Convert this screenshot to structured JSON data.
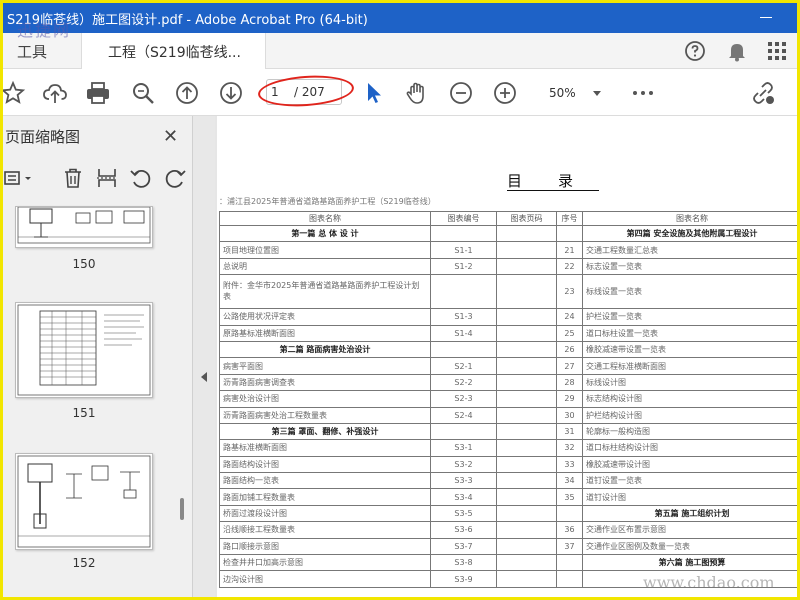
{
  "window": {
    "title": "S219临苍线）施工图设计.pdf - Adobe Acrobat Pro (64-bit)"
  },
  "tabs": {
    "tools_label": "工具",
    "document_tab_label": "工程（S219临苍线..."
  },
  "toolbar": {
    "current_page": "1",
    "total_pages": "/ 207",
    "zoom": "50%"
  },
  "thumbnail_panel": {
    "title": "页面缩略图",
    "pages": [
      "150",
      "151",
      "152"
    ]
  },
  "document": {
    "title": "目　　录",
    "subtitle": "：浦江县2025年普通省道路基路面养护工程（S219临苍线）",
    "headers": [
      "图表名称",
      "图表编号",
      "图表页码",
      "序号",
      "图表名称"
    ],
    "rows": [
      {
        "left": "第一篇  总 体 设 计",
        "left_head": true,
        "code": "",
        "no": "",
        "right": "第四篇  安全设施及其他附属工程设计",
        "right_head": true
      },
      {
        "left": "项目地理位置图",
        "code": "S1-1",
        "no": "21",
        "right": "交通工程数量汇总表"
      },
      {
        "left": "总说明",
        "code": "S1-2",
        "no": "22",
        "right": "标志设置一览表"
      },
      {
        "left": "附件：金华市2025年普通省道路基路面养护工程设计划表",
        "code": "",
        "no": "23",
        "right": "标线设置一览表",
        "tall": true
      },
      {
        "left": "公路使用状况评定表",
        "code": "S1-3",
        "no": "24",
        "right": "护栏设置一览表"
      },
      {
        "left": "原路基标准横断面图",
        "code": "S1-4",
        "no": "25",
        "right": "道口标柱设置一览表"
      },
      {
        "left": "第二篇  路面病害处治设计",
        "left_head": true,
        "code": "",
        "no": "26",
        "right": "橡胶减速带设置一览表"
      },
      {
        "left": "病害平面图",
        "code": "S2-1",
        "no": "27",
        "right": "交通工程标准横断面图"
      },
      {
        "left": "沥青路面病害调查表",
        "code": "S2-2",
        "no": "28",
        "right": "标线设计图"
      },
      {
        "left": "病害处治设计图",
        "code": "S2-3",
        "no": "29",
        "right": "标志结构设计图"
      },
      {
        "left": "沥青路面病害处治工程数量表",
        "code": "S2-4",
        "no": "30",
        "right": "护栏结构设计图"
      },
      {
        "left": "第三篇  罩面、翻修、补强设计",
        "left_head": true,
        "code": "",
        "no": "31",
        "right": "轮廓标一般构造图"
      },
      {
        "left": "路基标准横断面图",
        "code": "S3-1",
        "no": "32",
        "right": "道口标柱结构设计图"
      },
      {
        "left": "路面结构设计图",
        "code": "S3-2",
        "no": "33",
        "right": "橡胶减速带设计图"
      },
      {
        "left": "路面结构一览表",
        "code": "S3-3",
        "no": "34",
        "right": "道钉设置一览表"
      },
      {
        "left": "路面加铺工程数量表",
        "code": "S3-4",
        "no": "35",
        "right": "道钉设计图"
      },
      {
        "left": "桥面过渡段设计图",
        "code": "S3-5",
        "no": "",
        "right": "第五篇  施工组织计划",
        "right_head": true
      },
      {
        "left": "沿线顺接工程数量表",
        "code": "S3-6",
        "no": "36",
        "right": "交通作业区布置示意图"
      },
      {
        "left": "路口顺接示意图",
        "code": "S3-7",
        "no": "37",
        "right": "交通作业区图例及数量一览表"
      },
      {
        "left": "检查井井口加高示意图",
        "code": "S3-8",
        "no": "",
        "right": "第六篇  施工图预算",
        "right_head": true
      },
      {
        "left": "边沟设计图",
        "code": "S3-9",
        "no": "",
        "right": ""
      }
    ]
  },
  "watermarks": {
    "top_left": "迅捷网",
    "bottom_right": "www.chdao.com"
  },
  "colors": {
    "titlebar": "#1e62c7",
    "accent_blue": "#1e62c7",
    "annotation_red": "#e0241c",
    "frame_yellow": "#f2e600"
  }
}
